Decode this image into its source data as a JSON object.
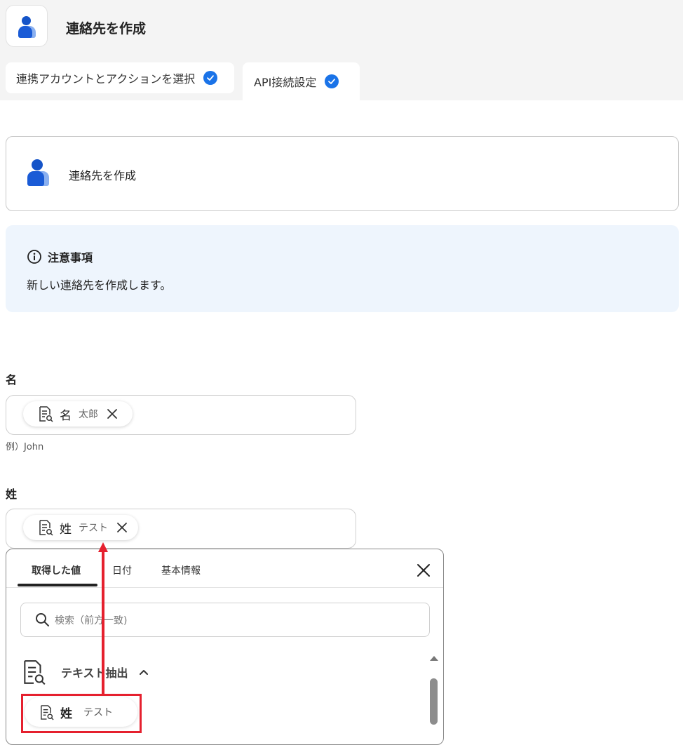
{
  "header": {
    "app_icon": "person-icon",
    "title": "連絡先を作成",
    "tabs": [
      {
        "label": "連携アカウントとアクションを選択",
        "done": true
      },
      {
        "label": "API接続設定",
        "done": true,
        "active": true
      }
    ]
  },
  "action_card": {
    "icon": "person-icon",
    "title": "連絡先を作成"
  },
  "notice": {
    "icon": "info-icon",
    "heading": "注意事項",
    "text": "新しい連絡先を作成します。"
  },
  "fields": {
    "first_name": {
      "label": "名",
      "chip": {
        "icon": "document-search-icon",
        "label": "名",
        "value": "太郎"
      },
      "hint": "例）John"
    },
    "last_name": {
      "label": "姓",
      "chip": {
        "icon": "document-search-icon",
        "label": "姓",
        "value": "テスト"
      }
    }
  },
  "dropdown": {
    "tabs": [
      {
        "label": "取得した値",
        "active": true
      },
      {
        "label": "日付"
      },
      {
        "label": "基本情報"
      }
    ],
    "search_placeholder": "検索（前方一致)",
    "section": {
      "icon": "document-search-icon",
      "label": "テキスト抽出",
      "expanded": true
    },
    "item": {
      "icon": "document-search-icon",
      "label": "姓",
      "value": "テスト"
    }
  },
  "colors": {
    "accent": "#1a73e8",
    "highlight": "#e5202e",
    "notice_bg": "#eef5fd",
    "header_bg": "#f4f4f4"
  }
}
